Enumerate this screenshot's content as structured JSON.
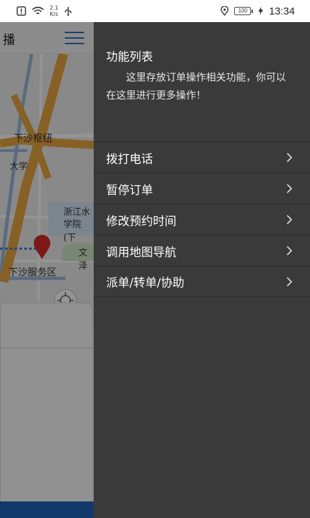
{
  "status_bar": {
    "network_speed_value": "2.1",
    "network_speed_unit": "K/s",
    "battery": "100",
    "time": "13:34"
  },
  "app": {
    "title": "播",
    "map_labels": {
      "hub": "下沙枢纽",
      "university": "大学",
      "college_line1": "浙江水",
      "college_line2": "学院(下",
      "wenze": "文泽",
      "service_area": "下沙服务区"
    }
  },
  "drawer": {
    "title": "功能列表",
    "description": "这里存放订单操作相关功能，你可以在这里进行更多操作！",
    "menu": [
      {
        "label": "拨打电话"
      },
      {
        "label": "暂停订单"
      },
      {
        "label": "修改预约时间"
      },
      {
        "label": "调用地图导航"
      },
      {
        "label": "派单/转单/协助"
      }
    ]
  },
  "colors": {
    "drawer_bg": "#3a3a3a",
    "accent_blue": "#1e63b7",
    "map_road_orange": "#e8a640",
    "map_pin_red": "#d62a2a"
  },
  "icons": [
    "warning-icon",
    "wifi-icon",
    "usb-icon",
    "location-icon",
    "battery-icon",
    "charging-icon",
    "hamburger-icon",
    "chevron-right-icon",
    "map-pin-icon",
    "locate-icon"
  ]
}
